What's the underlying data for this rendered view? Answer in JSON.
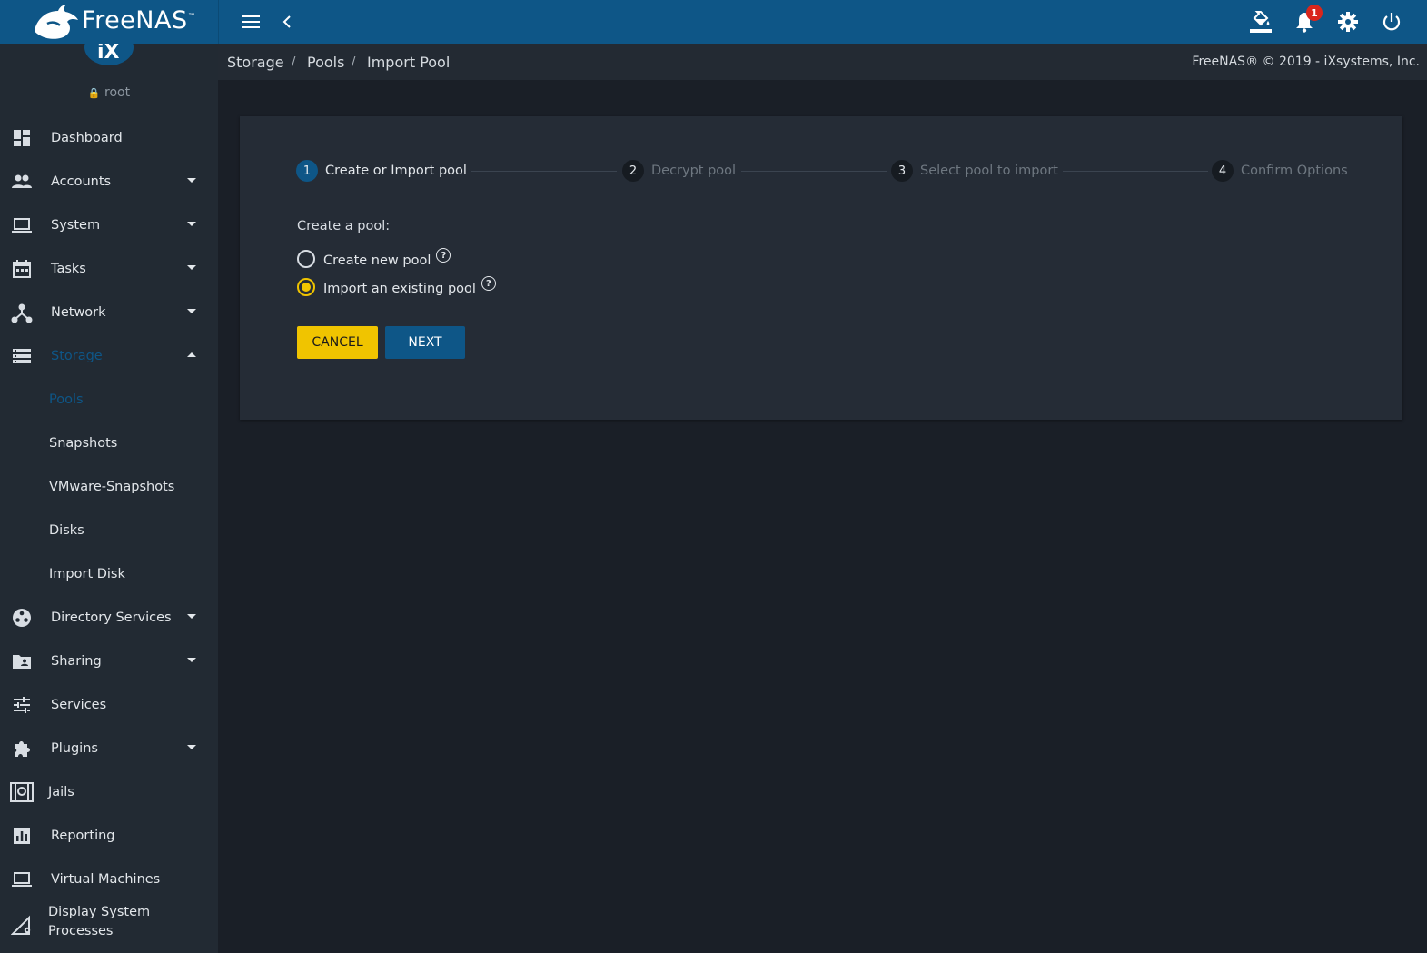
{
  "brand": {
    "name": "FreeNAS",
    "trademark": "™"
  },
  "topbar": {
    "notification_count": "1"
  },
  "user": {
    "name": "root"
  },
  "sidebar": {
    "items": [
      {
        "label": "Dashboard",
        "icon": "dashboard-icon",
        "caret": "none"
      },
      {
        "label": "Accounts",
        "icon": "people-icon",
        "caret": "down"
      },
      {
        "label": "System",
        "icon": "laptop-icon",
        "caret": "down"
      },
      {
        "label": "Tasks",
        "icon": "calendar-icon",
        "caret": "down"
      },
      {
        "label": "Network",
        "icon": "network-icon",
        "caret": "down"
      },
      {
        "label": "Storage",
        "icon": "storage-icon",
        "caret": "up",
        "active": true
      },
      {
        "label": "Directory Services",
        "icon": "directory-icon",
        "caret": "down"
      },
      {
        "label": "Sharing",
        "icon": "folder-shared-icon",
        "caret": "down"
      },
      {
        "label": "Services",
        "icon": "tune-icon",
        "caret": "none"
      },
      {
        "label": "Plugins",
        "icon": "puzzle-icon",
        "caret": "down"
      },
      {
        "label": "Jails",
        "icon": "jail-icon",
        "caret": "none"
      },
      {
        "label": "Reporting",
        "icon": "chart-icon",
        "caret": "none"
      },
      {
        "label": "Virtual Machines",
        "icon": "laptop-icon",
        "caret": "none"
      },
      {
        "label": "Display System Processes",
        "label_line1": "Display System",
        "label_line2": "Processes",
        "icon": "processes-icon",
        "caret": "none"
      }
    ],
    "storage_subitems": [
      {
        "label": "Pools",
        "active": true
      },
      {
        "label": "Snapshots"
      },
      {
        "label": "VMware-Snapshots"
      },
      {
        "label": "Disks"
      },
      {
        "label": "Import Disk"
      }
    ]
  },
  "breadcrumb": {
    "items": [
      "Storage",
      "Pools",
      "Import Pool"
    ]
  },
  "copyright": "FreeNAS® © 2019 - iXsystems, Inc.",
  "wizard": {
    "steps": [
      {
        "number": "1",
        "label": "Create or Import pool",
        "state": "current"
      },
      {
        "number": "2",
        "label": "Decrypt pool",
        "state": "pending"
      },
      {
        "number": "3",
        "label": "Select pool to import",
        "state": "pending"
      },
      {
        "number": "4",
        "label": "Confirm Options",
        "state": "pending"
      }
    ],
    "form_title": "Create a pool:",
    "options": [
      {
        "label": "Create new pool",
        "selected": false
      },
      {
        "label": "Import an existing pool",
        "selected": true
      }
    ],
    "help_glyph": "?",
    "cancel_label": "CANCEL",
    "next_label": "NEXT"
  },
  "colors": {
    "topbar": "#0e5687",
    "accent": "#0e5687",
    "warning": "#f0c400",
    "badge": "#d9261c"
  }
}
